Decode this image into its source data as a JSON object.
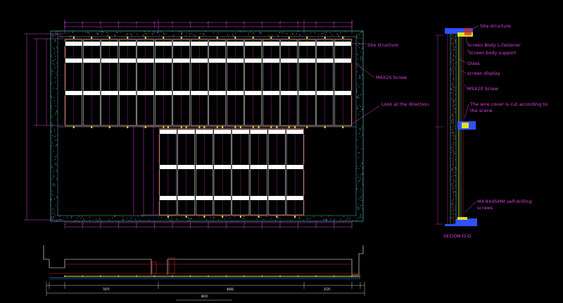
{
  "labels": {
    "site_structure_main": "Site structure",
    "screw_main": "M6X20 Screw",
    "look_direction": "Look at the direction",
    "site_structure_sec": "Site structure",
    "screen_body_fastener": "Screen Body L-fastener",
    "screen_body_support": "Screen body support",
    "glass": "Glass",
    "screen_display": "screen display",
    "screw_sec": "M5X20 Screw",
    "wire_cover_1": "The wire cover is cut according to",
    "wire_cover_2": "the scene",
    "self_drilling_1": "M4.8X45MM self-drilling",
    "self_drilling_2": "screws",
    "section_title": "SECION D-D"
  },
  "colors": {
    "magenta": "#e040e0",
    "cyan": "#40c0c0",
    "white": "#ffffff",
    "yellow": "#e0e020",
    "red": "#e02020",
    "blue": "#3050ff"
  },
  "dimensions": {
    "bottom_left": "7875",
    "bottom_center": "4050",
    "bottom_right": "2525",
    "bottom_total": "8915"
  }
}
